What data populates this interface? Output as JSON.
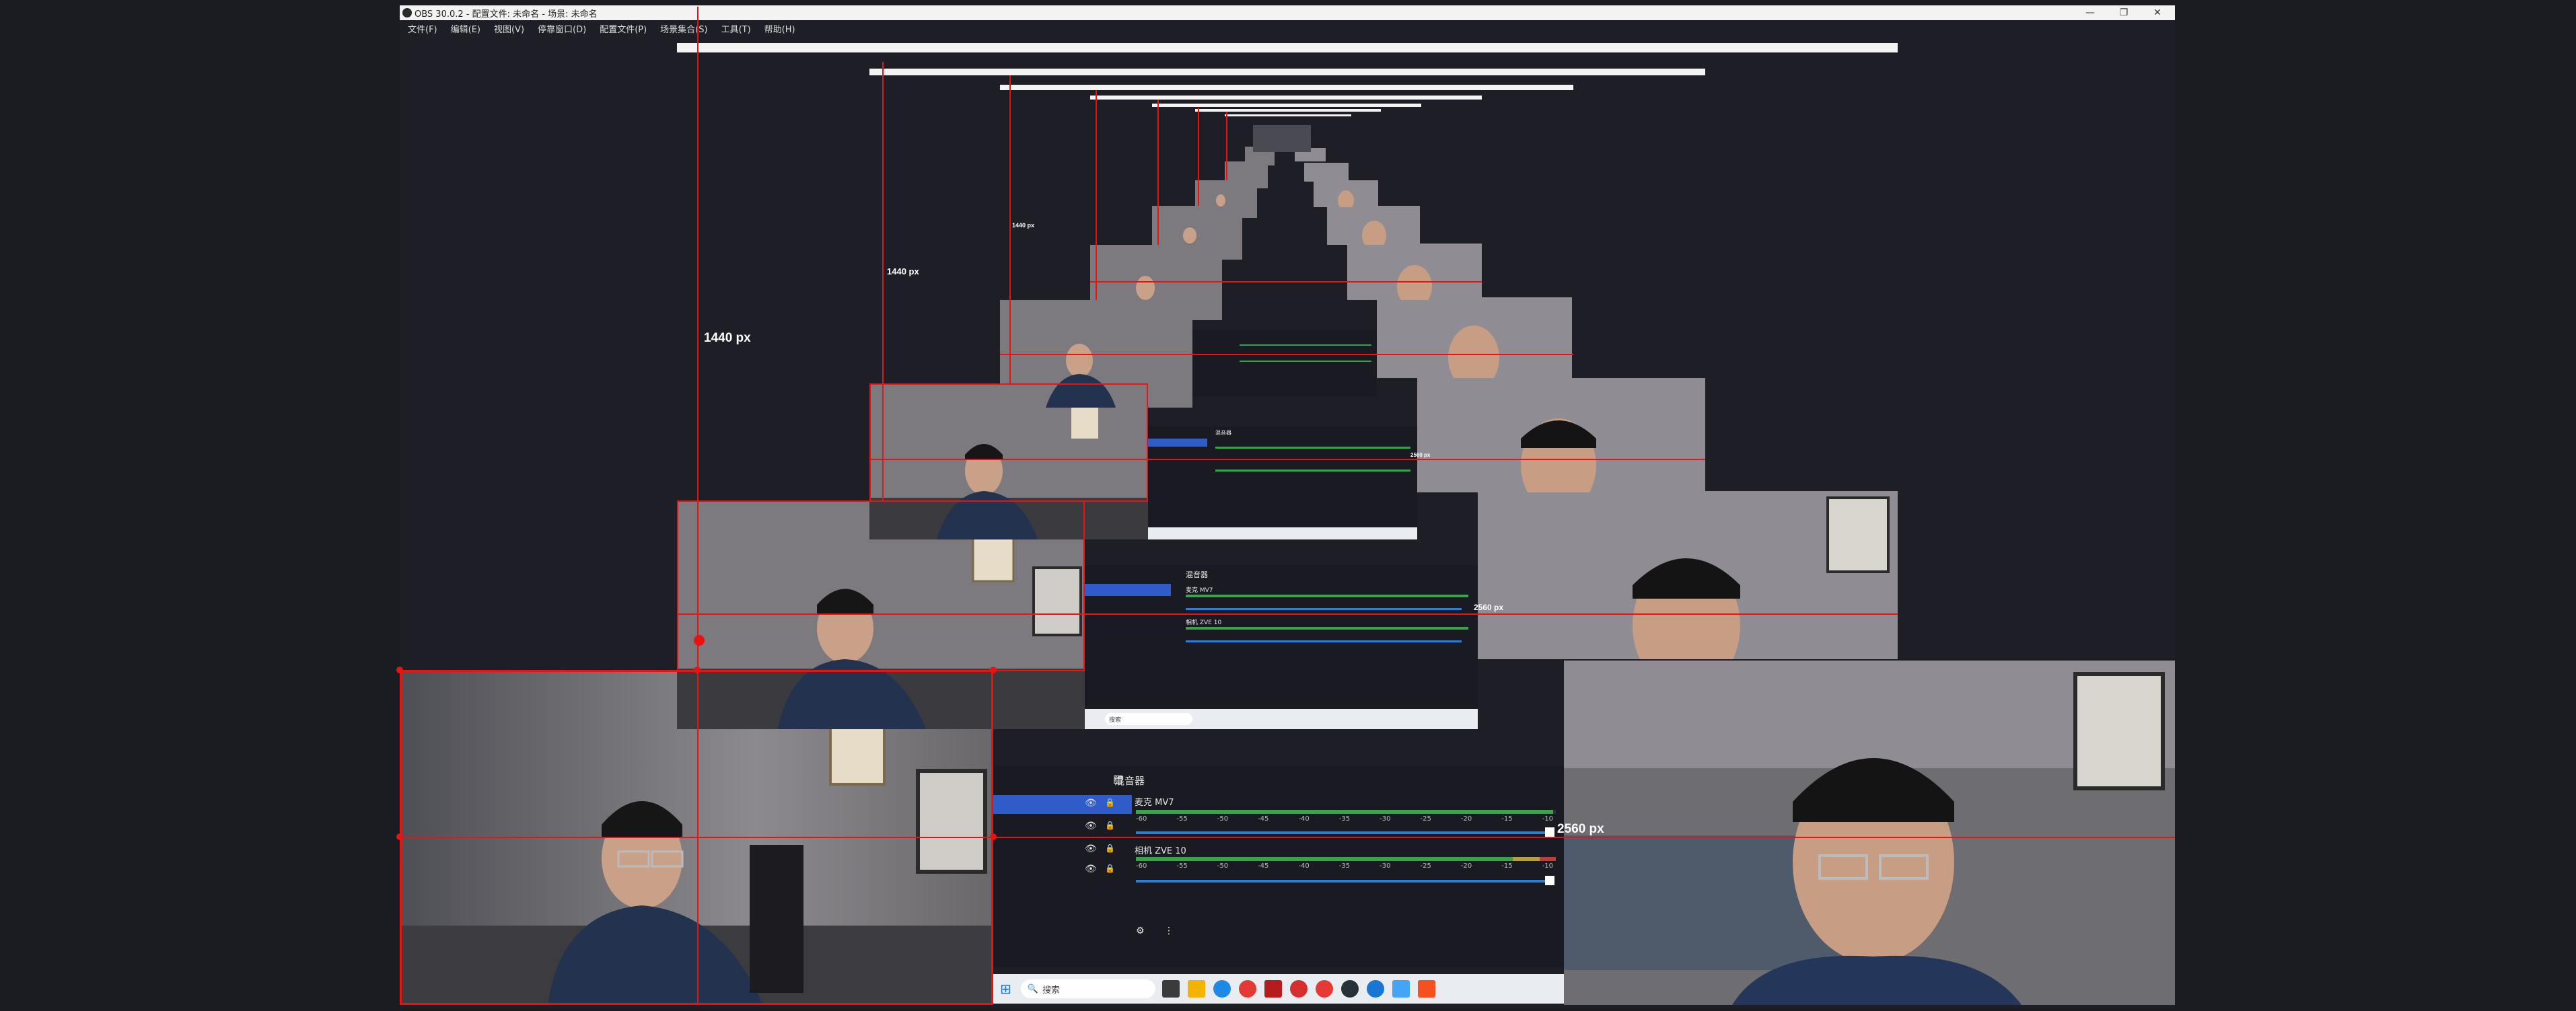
{
  "window": {
    "title": "OBS 30.0.2 - 配置文件: 未命名 - 场景: 未命名",
    "minimize_icon": "minimize-icon",
    "maximize_icon": "maximize-icon",
    "close_icon": "close-icon"
  },
  "menu": [
    "文件(F)",
    "编辑(E)",
    "视图(V)",
    "停靠窗口(D)",
    "配置文件(P)",
    "场景集合(S)",
    "工具(T)",
    "帮助(H)"
  ],
  "measurements": {
    "height_label": "1440 px",
    "width_label": "2560 px"
  },
  "mixer": {
    "header": "混音器",
    "tracks": [
      {
        "name": "麦克 MV7",
        "ticks": [
          "-60",
          "-55",
          "-50",
          "-45",
          "-40",
          "-35",
          "-30",
          "-25",
          "-20",
          "-15",
          "-10"
        ]
      },
      {
        "name": "相机 ZVE 10",
        "ticks": [
          "-60",
          "-55",
          "-50",
          "-45",
          "-40",
          "-35",
          "-30",
          "-25",
          "-20",
          "-15",
          "-10"
        ]
      }
    ]
  },
  "taskbar": {
    "search_placeholder": "搜索"
  },
  "colors": {
    "accent_red": "#e11111",
    "selection_blue": "#2f5cc8",
    "meter_green": "#3aa24b",
    "background": "#1b1c22"
  }
}
